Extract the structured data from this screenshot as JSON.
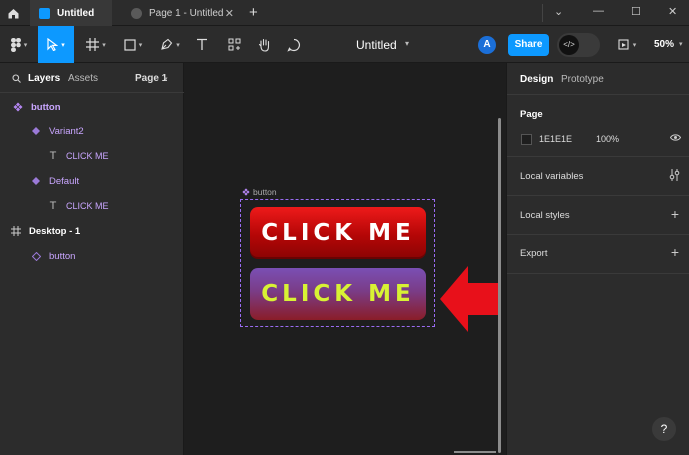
{
  "titlebar": {
    "tabs": [
      {
        "label": "Untitled",
        "active": true
      },
      {
        "label": "Page 1 - Untitled",
        "active": false
      }
    ]
  },
  "toolbar": {
    "doc_title": "Untitled",
    "avatar_initial": "A",
    "share_label": "Share",
    "zoom": "50%"
  },
  "left_panel": {
    "tabs": {
      "layers": "Layers",
      "assets": "Assets",
      "page": "Page 1"
    },
    "layers": [
      {
        "name": "button",
        "type": "component-set",
        "depth": 0
      },
      {
        "name": "Variant2",
        "type": "variant",
        "depth": 1
      },
      {
        "name": "CLICK ME",
        "type": "text",
        "depth": 2
      },
      {
        "name": "Default",
        "type": "variant",
        "depth": 1
      },
      {
        "name": "CLICK ME",
        "type": "text",
        "depth": 2
      },
      {
        "name": "Desktop - 1",
        "type": "frame",
        "depth": 0
      },
      {
        "name": "button",
        "type": "instance",
        "depth": 1
      }
    ]
  },
  "canvas": {
    "frame_label": "button",
    "button_default_text": "CLICK ME",
    "button_variant2_text": "CLICK ME"
  },
  "right_panel": {
    "tabs": {
      "design": "Design",
      "prototype": "Prototype"
    },
    "page": {
      "title": "Page",
      "color_hex": "1E1E1E",
      "opacity": "100%"
    },
    "sections": {
      "local_variables": "Local variables",
      "local_styles": "Local styles",
      "export": "Export"
    },
    "help": "?"
  },
  "colors": {
    "accent": "#0d99ff",
    "component": "#b486f2",
    "panel": "#2c2c2c",
    "canvas": "#1e1e1e",
    "arrow": "#e8101a"
  }
}
